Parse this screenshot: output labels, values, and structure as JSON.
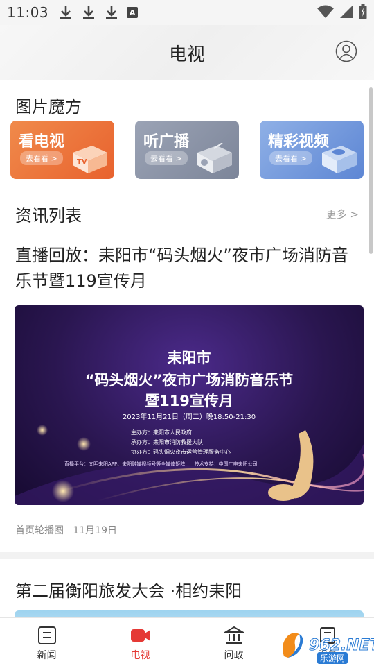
{
  "status_bar": {
    "time": "11:03",
    "notif_letter": "A"
  },
  "header": {
    "title": "电视"
  },
  "cube_section": {
    "title": "图片魔方",
    "items": [
      {
        "label": "看电视",
        "sub": "去看看 >",
        "art_text": "TV"
      },
      {
        "label": "听广播",
        "sub": "去看看 >"
      },
      {
        "label": "精彩视频",
        "sub": "去看看 >"
      }
    ]
  },
  "news_section": {
    "title": "资讯列表",
    "more": "更多 >",
    "items": [
      {
        "title": "直播回放：耒阳市“码头烟火”夜市广场消防音乐节暨119宣传月",
        "poster": {
          "line1": "耒阳市",
          "line2": "“码头烟火”夜市广场消防音乐节",
          "line3": "暨119宣传月",
          "date": "2023年11月21日（周二）晚18:50-21:30",
          "org1": "主办方：耒阳市人民政府",
          "org2": "承办方：耒阳市消防救援大队",
          "org3": "协办方：码头烟火夜市运营管理服务中心",
          "platform": "直播平台：文明耒阳APP、耒阳融媒视频号等全媒体矩阵      技术支持：中国广电耒阳公司"
        },
        "source": "首页轮播图",
        "date": "11月19日"
      },
      {
        "title": "第二届衡阳旅发大会 ·相约耒阳"
      }
    ]
  },
  "tabs": [
    {
      "label": "新闻",
      "icon": "news-icon",
      "active": false
    },
    {
      "label": "电视",
      "icon": "tv-camera-icon",
      "active": true
    },
    {
      "label": "问政",
      "icon": "government-icon",
      "active": false
    },
    {
      "label": "服务",
      "icon": "service-icon",
      "active": false
    }
  ],
  "colors": {
    "accent": "#e53935",
    "tv_cube": "#e8622e",
    "radio_cube": "#7c8599",
    "video_cube": "#5d86d4"
  },
  "watermark": {
    "text": "962.NET",
    "sub": "乐游网"
  }
}
